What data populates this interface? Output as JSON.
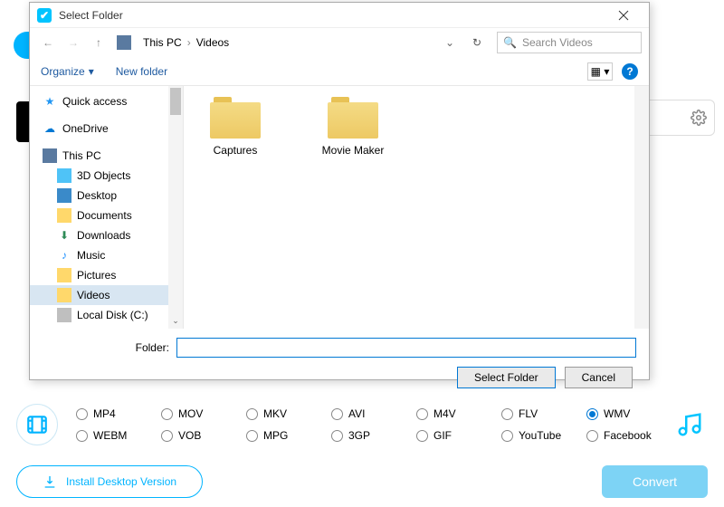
{
  "dialog": {
    "title": "Select Folder",
    "breadcrumb": {
      "root": "This PC",
      "current": "Videos"
    },
    "search_placeholder": "Search Videos",
    "toolbar": {
      "organize": "Organize",
      "new_folder": "New folder"
    },
    "sidebar": {
      "quick_access": "Quick access",
      "onedrive": "OneDrive",
      "this_pc": "This PC",
      "objects3d": "3D Objects",
      "desktop": "Desktop",
      "documents": "Documents",
      "downloads": "Downloads",
      "music": "Music",
      "pictures": "Pictures",
      "videos": "Videos",
      "local_disk": "Local Disk (C:)"
    },
    "folders": {
      "captures": "Captures",
      "movie_maker": "Movie Maker"
    },
    "footer": {
      "label": "Folder:",
      "value": "",
      "select": "Select Folder",
      "cancel": "Cancel"
    }
  },
  "formats": {
    "row1": [
      "MP4",
      "MOV",
      "MKV",
      "AVI",
      "M4V",
      "FLV",
      "WMV"
    ],
    "row2": [
      "WEBM",
      "VOB",
      "MPG",
      "3GP",
      "GIF",
      "YouTube",
      "Facebook"
    ],
    "selected": "WMV"
  },
  "bottom": {
    "install": "Install Desktop Version",
    "convert": "Convert"
  }
}
